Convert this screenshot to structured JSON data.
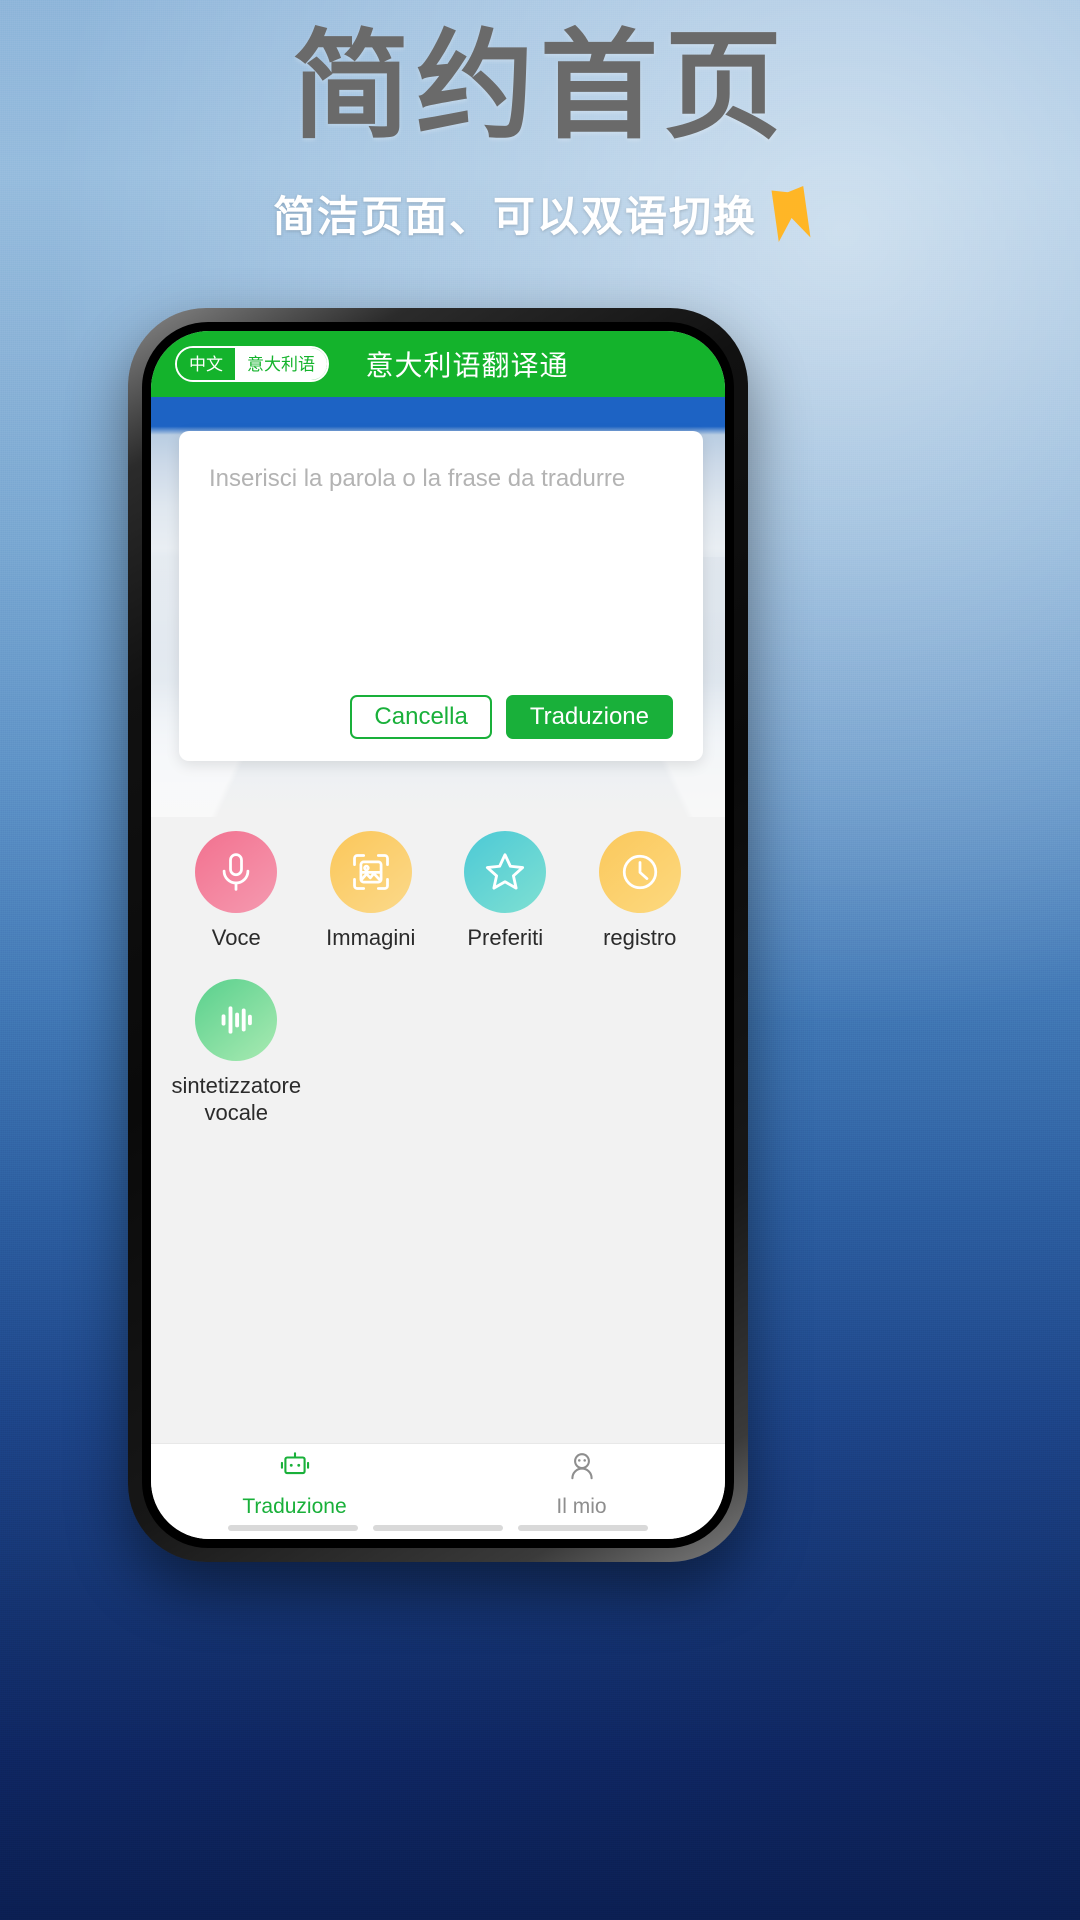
{
  "poster": {
    "title": "简约首页",
    "subtitle": "简洁页面、可以双语切换",
    "arrow_icon": "triangle-right-icon",
    "colors": {
      "title": "#6a6a6a",
      "subtitle": "#ffffff",
      "arrow": "#ffb626"
    }
  },
  "app": {
    "header": {
      "title": "意大利语翻译通",
      "language_toggle": {
        "source_label": "中文",
        "target_label": "意大利语",
        "active": "中文"
      },
      "accent_color": "#14b32c"
    },
    "input_card": {
      "placeholder": "Inserisci la parola o la frase da tradurre",
      "value": "",
      "cancel_label": "Cancella",
      "translate_label": "Traduzione"
    },
    "features": [
      {
        "label": "Voce",
        "icon": "microphone-icon",
        "color": "#f2718f"
      },
      {
        "label": "Immagini",
        "icon": "image-scan-icon",
        "color": "#fbc75a"
      },
      {
        "label": "Preferiti",
        "icon": "star-icon",
        "color": "#4cc9d6"
      },
      {
        "label": "registro",
        "icon": "clock-icon",
        "color": "#fbc85c"
      },
      {
        "label": "sintetizzatore vocale",
        "icon": "waveform-icon",
        "color": "#59d08d"
      }
    ],
    "tabs": [
      {
        "label": "Traduzione",
        "icon": "robot-icon",
        "active": true
      },
      {
        "label": "Il mio",
        "icon": "person-icon",
        "active": false
      }
    ]
  }
}
